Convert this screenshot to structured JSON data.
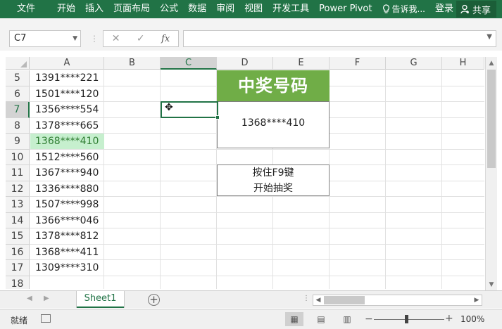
{
  "ribbon": {
    "tabs": [
      "文件",
      "开始",
      "插入",
      "页面布局",
      "公式",
      "数据",
      "审阅",
      "视图",
      "开发工具",
      "Power Pivot"
    ],
    "tell_me": "告诉我...",
    "login": "登录",
    "share": "共享",
    "bulb_icon": "lightbulb-icon",
    "user_icon": "person-icon"
  },
  "formula_bar": {
    "name_box": "C7",
    "cancel": "✕",
    "confirm": "✓",
    "fx": "fx",
    "content": ""
  },
  "columns": [
    "A",
    "B",
    "C",
    "D",
    "E",
    "F",
    "G",
    "H"
  ],
  "selected_column": "C",
  "rows": [
    {
      "row": "5",
      "a": "1391****221"
    },
    {
      "row": "6",
      "a": "1501****120"
    },
    {
      "row": "7",
      "a": "1356****554"
    },
    {
      "row": "8",
      "a": "1378****665"
    },
    {
      "row": "9",
      "a": "1368****410"
    },
    {
      "row": "10",
      "a": "1512****560"
    },
    {
      "row": "11",
      "a": "1367****940"
    },
    {
      "row": "12",
      "a": "1336****880"
    },
    {
      "row": "13",
      "a": "1507****998"
    },
    {
      "row": "14",
      "a": "1366****046"
    },
    {
      "row": "15",
      "a": "1378****812"
    },
    {
      "row": "16",
      "a": "1368****411"
    },
    {
      "row": "17",
      "a": "1309****310"
    },
    {
      "row": "18",
      "a": ""
    }
  ],
  "selected_row": "7",
  "highlighted_row": "9",
  "prize": {
    "title": "中奖号码",
    "number": "1368****410",
    "instruction_line1": "按住F9键",
    "instruction_line2": "开始抽奖"
  },
  "sheet_tab": "Sheet1",
  "status": {
    "ready": "就绪",
    "zoom": "100%",
    "minus": "−",
    "plus": "+"
  },
  "colors": {
    "excel_green": "#217346",
    "title_green": "#70ad47",
    "highlight_fill": "#c6efce",
    "highlight_text": "#2f7d32"
  }
}
